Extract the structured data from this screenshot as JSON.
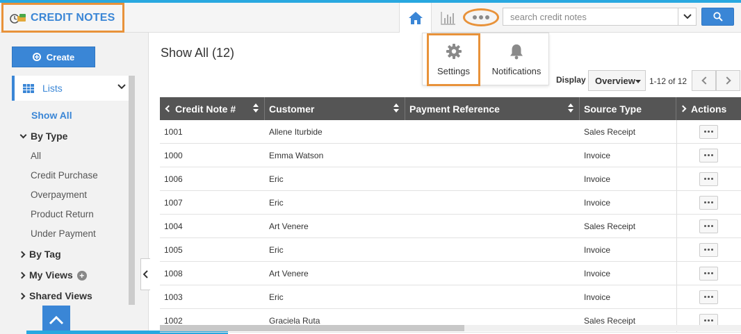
{
  "app": {
    "title": "CREDIT NOTES"
  },
  "header": {
    "search": {
      "placeholder": "search credit notes",
      "value": ""
    }
  },
  "more_menu": {
    "items": [
      {
        "label": "Settings",
        "icon": "gear-icon"
      },
      {
        "label": "Notifications",
        "icon": "bell-icon"
      }
    ]
  },
  "sidebar": {
    "create_label": "Create",
    "lists_label": "Lists",
    "show_all": "Show All",
    "by_type": "By Type",
    "types": [
      "All",
      "Credit Purchase",
      "Overpayment",
      "Product Return",
      "Under Payment"
    ],
    "by_tag": "By Tag",
    "my_views": "My Views",
    "shared_views": "Shared Views"
  },
  "main": {
    "title": "Show All (12)",
    "display_label": "Display",
    "display_value": "Overview",
    "pager": "1-12 of 12"
  },
  "table": {
    "columns": [
      "Credit Note #",
      "Customer",
      "Payment Reference",
      "Source Type",
      "Actions"
    ],
    "rows": [
      {
        "id": "1001",
        "customer": "Allene Iturbide",
        "ref": "",
        "source": "Sales Receipt"
      },
      {
        "id": "1000",
        "customer": "Emma Watson",
        "ref": "",
        "source": "Invoice"
      },
      {
        "id": "1006",
        "customer": "Eric",
        "ref": "",
        "source": "Invoice"
      },
      {
        "id": "1007",
        "customer": "Eric",
        "ref": "",
        "source": "Invoice"
      },
      {
        "id": "1004",
        "customer": "Art Venere",
        "ref": "",
        "source": "Sales Receipt"
      },
      {
        "id": "1005",
        "customer": "Eric",
        "ref": "",
        "source": "Invoice"
      },
      {
        "id": "1008",
        "customer": "Art Venere",
        "ref": "",
        "source": "Invoice"
      },
      {
        "id": "1003",
        "customer": "Eric",
        "ref": "",
        "source": "Invoice"
      },
      {
        "id": "1002",
        "customer": "Graciela Ruta",
        "ref": "",
        "source": "Sales Receipt"
      }
    ]
  },
  "colors": {
    "brand_blue": "#3a86d6",
    "highlight_orange": "#e8923a",
    "header_dark": "#555555"
  }
}
